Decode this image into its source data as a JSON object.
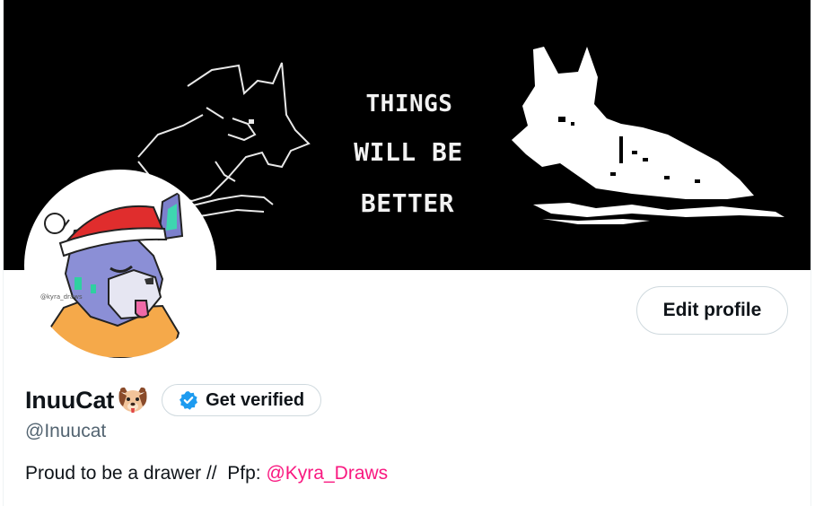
{
  "banner": {
    "text_lines": [
      "THINGS",
      "WILL BE",
      "BETTER"
    ],
    "background": "#000000"
  },
  "avatar": {
    "signature": "@kyra_draws"
  },
  "actions": {
    "edit_profile_label": "Edit profile"
  },
  "profile": {
    "display_name": "InuuCat",
    "name_emoji": "dog-face-icon",
    "verify_label": "Get verified",
    "handle": "@Inuucat",
    "bio_prefix": "Proud to be a drawer //  Pfp: ",
    "bio_link": "@Kyra_Draws"
  },
  "colors": {
    "text_primary": "#0f1419",
    "text_secondary": "#536471",
    "link": "#f91880",
    "verified_blue": "#1d9bf0",
    "border": "#cfd9de"
  }
}
